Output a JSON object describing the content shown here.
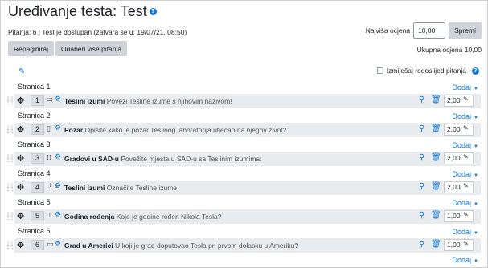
{
  "header": {
    "title": "Uređivanje testa: Test",
    "help": "?",
    "info": "Pitanja: 6 | Test je dostupan (zatvara se u: 19/07/21, 08:50)"
  },
  "grading": {
    "max_label": "Najviša ocjena",
    "max_value": "10,00",
    "save_label": "Spremi",
    "total": "Ukupna ocjena 10,00"
  },
  "actions": {
    "repaginate": "Repaginiraj",
    "select_multiple": "Odaberi više pitanja"
  },
  "shuffle": {
    "label": "Izmiješaj redoslijed pitanja",
    "checked": false
  },
  "add_label": "Dodaj",
  "pages": [
    {
      "label": "Stranica 1",
      "question": {
        "slot": "1",
        "icon": "match-icon",
        "name": "Teslini izumi",
        "text": "Poveži Tesline izume s njihovim nazivom!",
        "mark": "2,00"
      }
    },
    {
      "label": "Stranica 2",
      "question": {
        "slot": "2",
        "icon": "essay-icon",
        "name": "Požar",
        "text": "Opišite kako je požar Teslinog laboratorija utjecao na njegov život?",
        "mark": "2,00"
      }
    },
    {
      "label": "Stranica 3",
      "question": {
        "slot": "3",
        "icon": "ddmarker-icon",
        "name": "Gradovi u SAD-u",
        "text": "Povežite mjesta u SAD-u sa Teslinim izumima:",
        "mark": "2,00"
      }
    },
    {
      "label": "Stranica 4",
      "question": {
        "slot": "4",
        "icon": "multichoice-icon",
        "name": "Teslini izumi",
        "text": "Označite Tesline izume",
        "mark": "2,00"
      }
    },
    {
      "label": "Stranica 5",
      "question": {
        "slot": "5",
        "icon": "numerical-icon",
        "name": "Godina rođenja",
        "text": "Koje je godine rođen Nikola Tesla?",
        "mark": "1,00"
      }
    },
    {
      "label": "Stranica 6",
      "question": {
        "slot": "6",
        "icon": "shortanswer-icon",
        "name": "Grad u Americi",
        "text": "U koji je grad doputovao Tesla pri prvom dolasku u Ameriku?",
        "mark": "1,00"
      }
    }
  ]
}
